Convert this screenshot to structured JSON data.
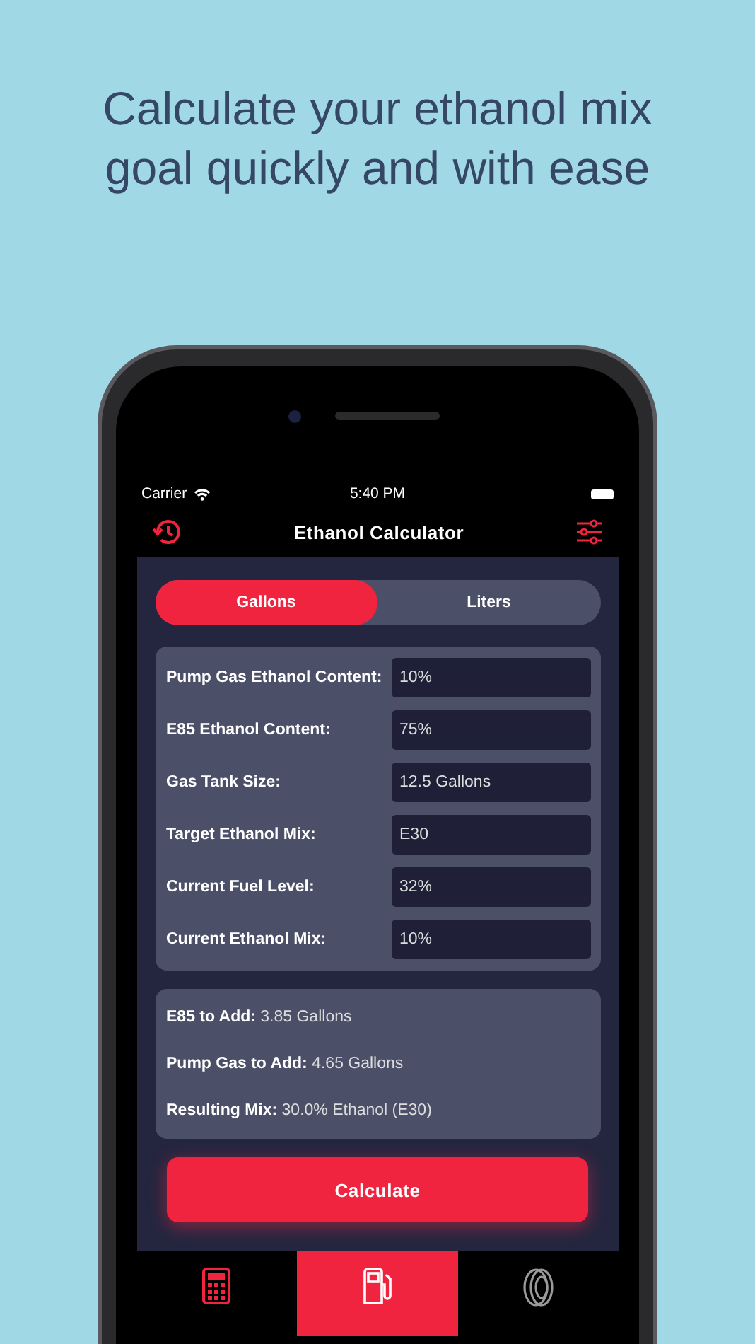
{
  "headline": [
    "Calculate your ethanol mix",
    "goal quickly and with ease"
  ],
  "status_bar": {
    "carrier": "Carrier",
    "time": "5:40 PM"
  },
  "nav": {
    "title": "Ethanol Calculator"
  },
  "unit_tabs": [
    {
      "label": "Gallons",
      "selected": true
    },
    {
      "label": "Liters",
      "selected": false
    }
  ],
  "form": [
    {
      "label": "Pump Gas Ethanol Content:",
      "value": "10%"
    },
    {
      "label": "E85 Ethanol Content:",
      "value": "75%"
    },
    {
      "label": "Gas Tank Size:",
      "value": "12.5 Gallons"
    },
    {
      "label": "Target Ethanol Mix:",
      "value": "E30"
    },
    {
      "label": "Current Fuel Level:",
      "value": "32%"
    },
    {
      "label": "Current Ethanol Mix:",
      "value": "10%"
    }
  ],
  "results": [
    "**E85 to Add:** 3.85 Gallons",
    "**Pump Gas to Add:** 4.65 Gallons",
    "**Resulting Mix:** 30.0% Ethanol (E30)"
  ],
  "button": "Calculate",
  "tab_bar": [
    {
      "kind": "calculator",
      "selected": false
    },
    {
      "kind": "pump",
      "selected": true
    },
    {
      "kind": "tire",
      "selected": false
    }
  ]
}
